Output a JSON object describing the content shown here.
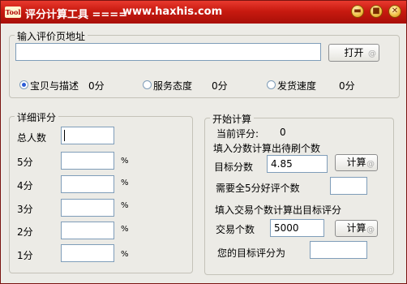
{
  "titlebar": {
    "icon_text": "Tool",
    "title": "评分计算工具 ====",
    "url": "www.haxhis.com",
    "minimize": "▬",
    "maximize": "■",
    "close": "✕"
  },
  "url_group": {
    "legend": "输入评价页地址",
    "input_value": "",
    "open_button": "打开",
    "ratings": [
      {
        "label": "宝贝与描述",
        "value": "0分",
        "checked": true
      },
      {
        "label": "服务态度",
        "value": "0分",
        "checked": false
      },
      {
        "label": "发货速度",
        "value": "0分",
        "checked": false
      }
    ]
  },
  "detail_group": {
    "legend": "详细评分",
    "total_label": "总人数",
    "total_value": "",
    "rows": [
      {
        "label": "5分",
        "value": "",
        "unit": "%"
      },
      {
        "label": "4分",
        "value": "",
        "unit": "%"
      },
      {
        "label": "3分",
        "value": "",
        "unit": "%"
      },
      {
        "label": "2分",
        "value": "",
        "unit": "%"
      },
      {
        "label": "1分",
        "value": "",
        "unit": "%"
      }
    ]
  },
  "calc_group": {
    "legend": "开始计算",
    "current_label": "当前评分:",
    "current_value": "0",
    "section1_title": "填入分数计算出待刷个数",
    "target_label": "目标分数",
    "target_value": "4.85",
    "calc_button_1": "计算",
    "need_label": "需要全5分好评个数",
    "need_value": "",
    "section2_title": "填入交易个数计算出目标评分",
    "trade_label": "交易个数",
    "trade_value": "5000",
    "calc_button_2": "计算",
    "result_label": "您的目标评分为",
    "result_value": ""
  }
}
